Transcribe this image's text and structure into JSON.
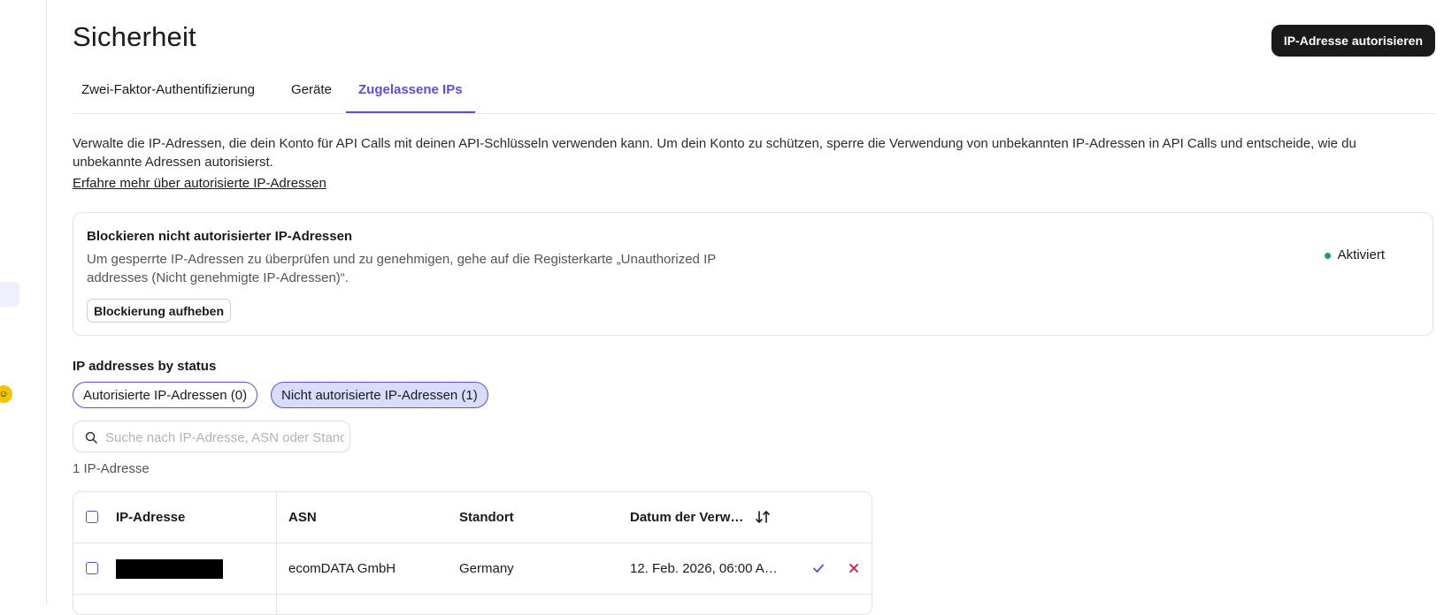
{
  "header": {
    "title": "Sicherheit",
    "primary_action": "IP-Adresse autorisieren"
  },
  "tabs": [
    {
      "label": "Zwei-Faktor-Authentifizierung",
      "active": false
    },
    {
      "label": "Geräte",
      "active": false
    },
    {
      "label": "Zugelassene IPs",
      "active": true
    }
  ],
  "intro": {
    "text": "Verwalte die IP-Adressen, die dein Konto für API Calls mit deinen API-Schlüsseln verwenden kann. Um dein Konto zu schützen, sperre die Verwendung von unbekannten IP-Adressen in API Calls und entscheide, wie du unbekannte Adressen autorisierst.",
    "link": "Erfahre mehr über autorisierte IP-Adressen"
  },
  "block_card": {
    "title": "Blockieren nicht autorisierter IP-Adressen",
    "description": "Um gesperrte IP-Adressen zu überprüfen und zu genehmigen, gehe auf die Registerkarte „Unauthorized IP addresses (Nicht genehmigte IP-Adressen)“.",
    "button": "Blockierung aufheben",
    "status": "Aktiviert",
    "status_color": "#1aa06d"
  },
  "status_section": {
    "label": "IP addresses by status",
    "filters": [
      {
        "label": "Autorisierte IP-Adressen (0)",
        "selected": false
      },
      {
        "label": "Nicht autorisierte IP-Adressen (1)",
        "selected": true
      }
    ]
  },
  "search": {
    "placeholder": "Suche nach IP-Adresse, ASN oder Standort",
    "value": ""
  },
  "result_count": "1 IP-Adresse",
  "table": {
    "columns": [
      "IP-Adresse",
      "ASN",
      "Standort",
      "Datum der Verw…"
    ],
    "rows": [
      {
        "ip": "",
        "asn": "ecomDATA GmbH",
        "location": "Germany",
        "date": "12. Feb. 2026, 06:00 A…"
      }
    ]
  },
  "colors": {
    "accent": "#5b4fd6",
    "primary_button": "#1a1a1a",
    "reject": "#d6143a",
    "selected_filter_bg": "#d9dbff"
  },
  "icons": [
    "search-icon",
    "sort-icon",
    "check-icon",
    "close-icon"
  ]
}
